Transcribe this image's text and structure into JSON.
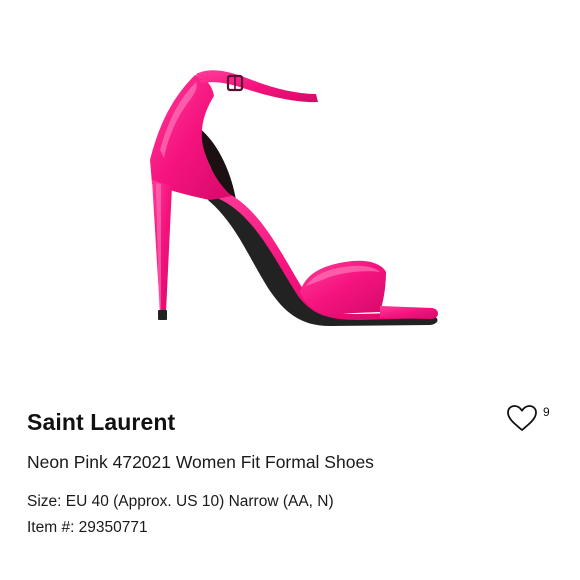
{
  "product": {
    "image": {
      "alt": "Neon pink patent leather ankle strap stiletto sandal",
      "color": "#ff1f8a"
    },
    "brand": "Saint Laurent",
    "title": "Neon Pink 472021 Women Fit Formal Shoes",
    "size_line": "Size: EU 40 (Approx. US 10) Narrow (AA, N)",
    "item_line": "Item #: 29350771"
  },
  "favorite": {
    "icon": "heart-outline-icon",
    "count": "9"
  }
}
